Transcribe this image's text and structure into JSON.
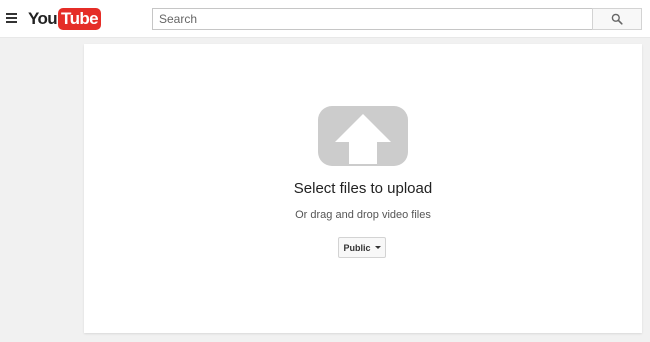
{
  "header": {
    "logo_you": "You",
    "logo_tube": "Tube",
    "search_placeholder": "Search"
  },
  "upload": {
    "title": "Select files to upload",
    "subtitle": "Or drag and drop video files",
    "privacy_label": "Public"
  },
  "icons": {
    "menu": "hamburger-menu-icon",
    "search": "search-icon",
    "upload": "upload-arrow-icon",
    "dropdown": "caret-down-icon"
  },
  "colors": {
    "brand_red": "#e52d27",
    "upload_icon_gray": "#cccccc",
    "page_background": "#f1f1f1"
  }
}
